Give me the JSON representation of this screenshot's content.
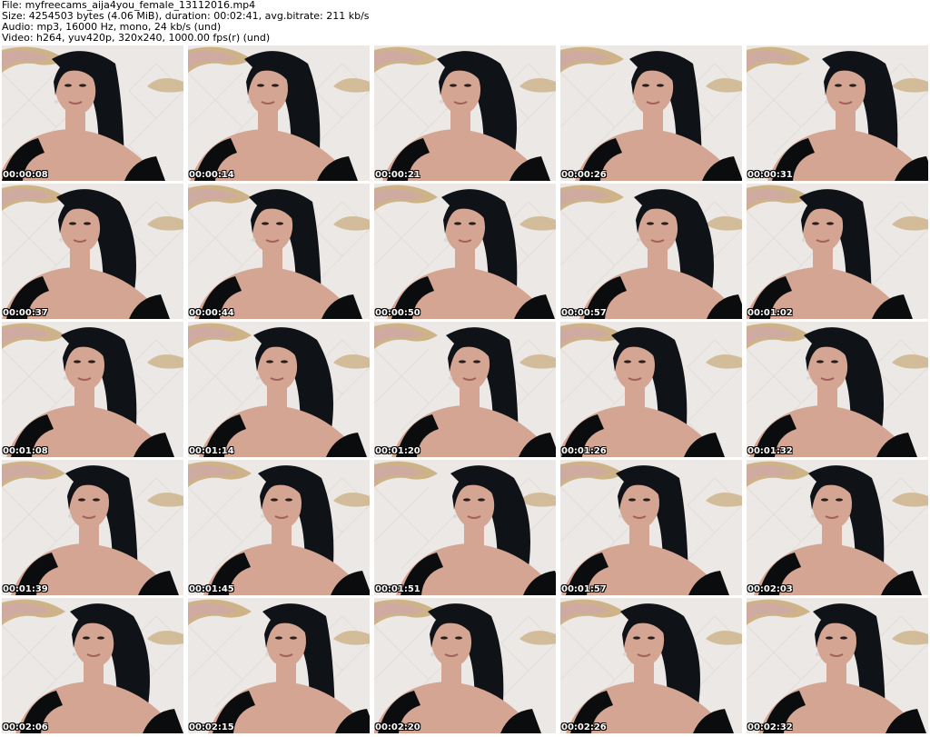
{
  "info": {
    "file": "File: myfreecams_aija4you_female_13112016.mp4",
    "size": "Size: 4254503 bytes (4.06 MiB), duration: 00:02:41, avg.bitrate: 211 kb/s",
    "audio": "Audio: mp3, 16000 Hz, mono, 24 kb/s (und)",
    "video": "Video: h264, yuv420p, 320x240, 1000.00 fps(r) (und)"
  },
  "thumbnails": [
    {
      "timestamp": "00:00:08"
    },
    {
      "timestamp": "00:00:14"
    },
    {
      "timestamp": "00:00:21"
    },
    {
      "timestamp": "00:00:26"
    },
    {
      "timestamp": "00:00:31"
    },
    {
      "timestamp": "00:00:37"
    },
    {
      "timestamp": "00:00:44"
    },
    {
      "timestamp": "00:00:50"
    },
    {
      "timestamp": "00:00:57"
    },
    {
      "timestamp": "00:01:02"
    },
    {
      "timestamp": "00:01:08"
    },
    {
      "timestamp": "00:01:14"
    },
    {
      "timestamp": "00:01:20"
    },
    {
      "timestamp": "00:01:26"
    },
    {
      "timestamp": "00:01:32"
    },
    {
      "timestamp": "00:01:39"
    },
    {
      "timestamp": "00:01:45"
    },
    {
      "timestamp": "00:01:51"
    },
    {
      "timestamp": "00:01:57"
    },
    {
      "timestamp": "00:02:03"
    },
    {
      "timestamp": "00:02:06"
    },
    {
      "timestamp": "00:02:15"
    },
    {
      "timestamp": "00:02:20"
    },
    {
      "timestamp": "00:02:26"
    },
    {
      "timestamp": "00:02:32"
    }
  ],
  "colors": {
    "background": "#ffffff",
    "wall": "#ebe8e6",
    "frame_gold": "#c9a978",
    "frame_pink": "#cfa7a6",
    "hair": "#0f1216",
    "skin": "#d4a592",
    "dress": "#0b0c0e"
  }
}
